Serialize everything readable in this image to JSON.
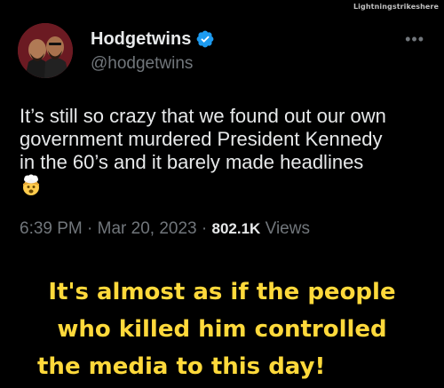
{
  "watermark": "Lightningstrikeshere",
  "tweet": {
    "display_name": "Hodgetwins",
    "handle": "@hodgetwins",
    "more_icon": "more-options-icon",
    "verified_icon": "verified-badge-icon",
    "body_lines": [
      "It’s still so crazy that we found out our own",
      "government murdered President Kennedy",
      "in the 60’s and it barely made headlines"
    ],
    "emoji_icon": "exploding-head-emoji",
    "time": "6:39 PM",
    "separator": "·",
    "date": "Mar 20, 2023",
    "views_count": "802.1K",
    "views_label": "Views"
  },
  "caption": {
    "lines": [
      "It's almost as if the people",
      "who killed him controlled",
      "the media to this day!"
    ],
    "color": "#ffd93b"
  },
  "colors": {
    "background": "#000000",
    "primary_text": "#e7e9ea",
    "secondary_text": "#71767b",
    "verified_blue": "#1d9bf0"
  }
}
